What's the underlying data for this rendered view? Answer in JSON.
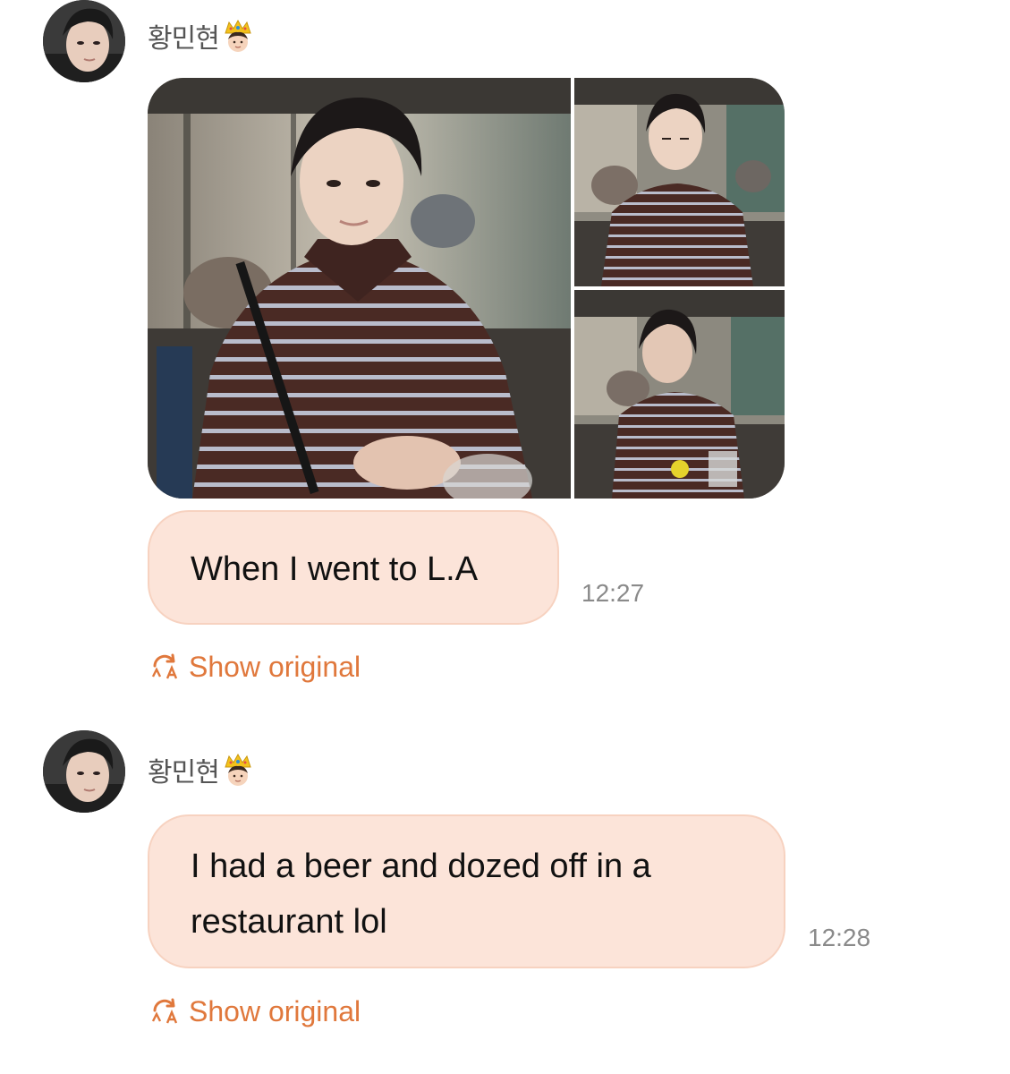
{
  "messages": [
    {
      "sender": "황민현",
      "sender_badge_icon": "crown-emoji-icon",
      "photos": [
        "main-photo",
        "top-right-photo",
        "bottom-right-photo"
      ],
      "text": "When I went to L.A",
      "time": "12:27",
      "show_original_label": "Show original"
    },
    {
      "sender": "황민현",
      "sender_badge_icon": "crown-emoji-icon",
      "text_line1": "I had a beer and dozed off in a",
      "text_line2": "restaurant lol",
      "time": "12:28",
      "show_original_label": "Show original"
    }
  ],
  "colors": {
    "bubble_bg": "#fce4d9",
    "bubble_border": "#f7d2c0",
    "accent": "#e0783c",
    "time": "#8a8a8a"
  }
}
